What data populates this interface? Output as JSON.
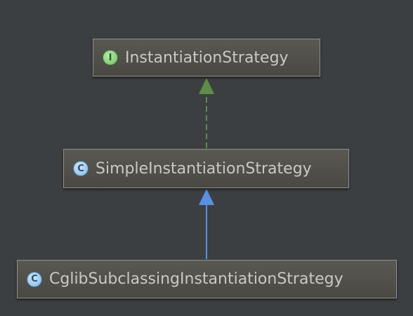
{
  "nodes": {
    "interface": {
      "badge": "I",
      "label": "InstantiationStrategy"
    },
    "simple": {
      "badge": "C",
      "label": "SimpleInstantiationStrategy"
    },
    "cglib": {
      "badge": "C",
      "label": "CglibSubclassingInstantiationStrategy"
    }
  },
  "colors": {
    "background": "#3c3f41",
    "implements_edge": "#5f8c48",
    "extends_edge": "#5b8fe0",
    "node_text": "#c9c9c6"
  }
}
